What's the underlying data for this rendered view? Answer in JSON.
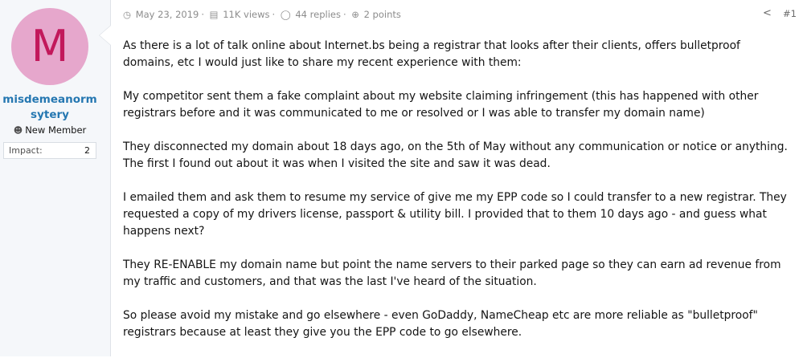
{
  "user": {
    "avatar_letter": "M",
    "avatar_bg": "#e6a7cc",
    "avatar_fg": "#c2185b",
    "username_line1": "misdemeanorm",
    "username_line2": "sytery",
    "rank_icon": "user-icon",
    "rank": "New Member",
    "impact_label": "Impact:",
    "impact_value": "2"
  },
  "post": {
    "date_icon": "clock-icon",
    "date": "May 23, 2019",
    "views_icon": "bar-chart-icon",
    "views": "11K views",
    "replies_icon": "comment-icon",
    "replies": "44 replies",
    "points_icon": "plus-circle-icon",
    "points": "2 points",
    "share_icon": "share-icon",
    "post_number": "#1",
    "paragraphs": [
      "As there is a lot of talk online about Internet.bs being a registrar that looks after their clients, offers bulletproof domains, etc I would just like to share my recent experience with them:",
      "My competitor sent them a fake complaint about my website claiming infringement (this has happened with other registrars before and it was communicated to me or resolved or I was able to transfer my domain name)",
      "They disconnected my domain about 18 days ago, on the 5th of May without any communication or notice or anything. The first I found out about it was when I visited the site and saw it was dead.",
      "I emailed them and ask them to resume my service of give me my EPP code so I could transfer to a new registrar. They requested a copy of my drivers license, passport & utility bill. I provided that to them 10 days ago - and guess what happens next?",
      "They RE-ENABLE my domain name but point the name servers to their parked page so they can earn ad revenue from my traffic and customers, and that was the last I've heard of the situation.",
      "So please avoid my mistake and go elsewhere - even GoDaddy, NameCheap etc are more reliable as \"bulletproof\" registrars because at least they give you the EPP code to go elsewhere."
    ]
  }
}
